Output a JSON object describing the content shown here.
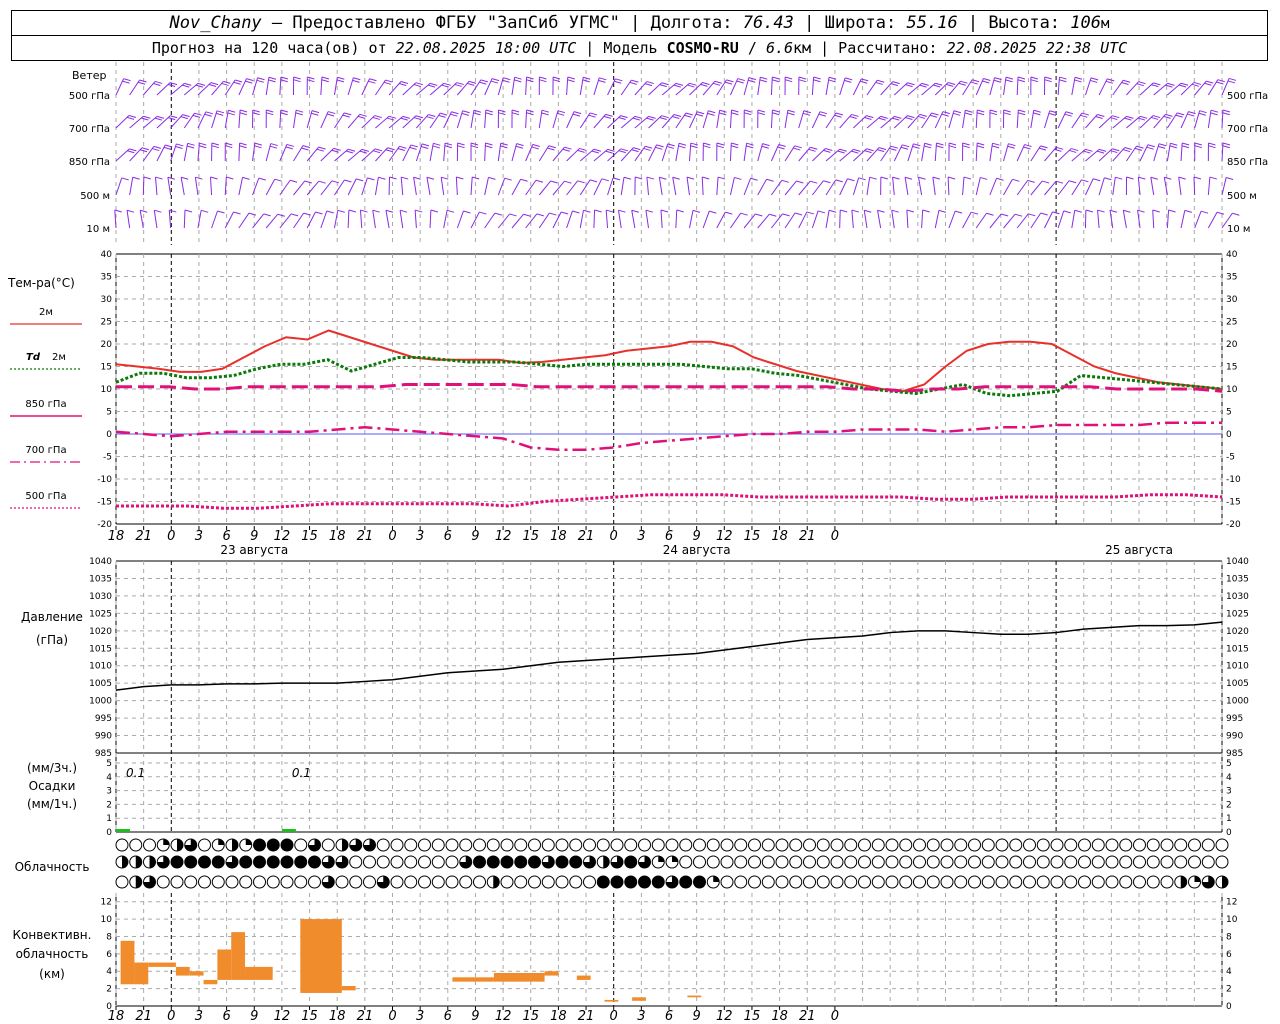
{
  "header": {
    "station": "Nov_Chany",
    "provided": " – Предоставлено ФГБУ \"ЗапСиб УГМС\" | Долгота: ",
    "lon": "76.43",
    "lat_label": " | Широта: ",
    "lat": "55.16",
    "alt_label": " | Высота: ",
    "alt": "106",
    "alt_unit": "м",
    "forecast_label": "Прогноз на 120 часа(ов) от ",
    "forecast_time": "22.08.2025 18:00 UTC",
    "model_label": " | Модель ",
    "model": "COSMO-RU",
    "model_sep": " / ",
    "model_res": "6.6",
    "model_res_unit": "км",
    "computed_label": " | Рассчитано: ",
    "computed_time": "22.08.2025 22:38 UTC"
  },
  "colors": {
    "wind": "#8a2be2",
    "t2m": "#e8302a",
    "td2m": "#0a7a0a",
    "t850": "#e0107a",
    "precip": "#22bb22",
    "convective": "#f08c2c",
    "pressure": "#000000"
  },
  "wind_panel": {
    "title": "Ветер",
    "levels": [
      "500 гПа",
      "700 гПа",
      "850 гПа",
      "500 м",
      "10 м"
    ]
  },
  "temp_panel": {
    "title": "Тем-ра(°C)",
    "legend": [
      {
        "label": "2м",
        "italic_prefix": "",
        "style": "solid",
        "color": "#e8302a"
      },
      {
        "label": "2м",
        "italic_prefix": "Td",
        "style": "dotted",
        "color": "#0a7a0a"
      },
      {
        "label": "850 гПа",
        "italic_prefix": "",
        "style": "solid",
        "color": "#e0107a"
      },
      {
        "label": "700 гПа",
        "italic_prefix": "",
        "style": "dashdot",
        "color": "#e0107a"
      },
      {
        "label": "500 гПа",
        "italic_prefix": "",
        "style": "dotted",
        "color": "#e0107a"
      }
    ]
  },
  "x_axis": {
    "hour_ticks": [
      "18",
      "21",
      "0",
      "3",
      "6",
      "9",
      "12",
      "15",
      "18",
      "21",
      "0",
      "3",
      "6",
      "9",
      "12",
      "15",
      "18",
      "21",
      "0",
      "3",
      "6",
      "9",
      "12",
      "15",
      "18",
      "21",
      "0"
    ],
    "dates": [
      "23 августа",
      "24 августа",
      "25 августа"
    ]
  },
  "pressure_panel": {
    "title": "Давление",
    "unit": "(гПа)"
  },
  "precip_panel": {
    "unit_top": "(мм/3ч.)",
    "title": "Осадки",
    "unit_bottom": "(мм/1ч.)",
    "labels": [
      "0.1",
      "0.1"
    ]
  },
  "cloud_panel": {
    "title": "Облачность"
  },
  "convective_panel": {
    "title_line1": "Конвективн.",
    "title_line2": "облачность",
    "unit": "(км)"
  },
  "chart_data": [
    {
      "type": "line",
      "panel": "temperature",
      "x_hours": [
        0,
        3,
        6,
        9,
        12,
        15,
        18,
        21,
        24,
        27,
        30,
        33,
        36,
        39,
        42,
        45,
        48,
        51,
        54,
        57,
        60,
        63,
        66,
        69,
        72,
        75,
        78,
        81,
        84,
        87,
        90,
        93,
        96,
        99,
        102,
        105,
        108,
        111,
        114,
        117,
        120
      ],
      "ylim": [
        -20,
        40
      ],
      "yticks": [
        -20,
        -15,
        -10,
        -5,
        0,
        5,
        10,
        15,
        20,
        25,
        30,
        35,
        40
      ],
      "series": [
        {
          "name": "2м",
          "values": [
            15.5,
            15,
            14.5,
            13.8,
            13.8,
            14.5,
            17,
            19.5,
            21.5,
            21,
            23,
            21.5,
            20,
            18.5,
            17,
            16.5,
            16.5,
            16.5,
            16.5,
            15.8,
            16,
            16.5,
            17,
            17.5,
            18.5,
            19,
            19.5,
            20.5,
            20.5,
            19.5,
            17,
            15.5,
            14,
            13,
            12,
            11,
            10,
            9.5,
            11,
            15,
            18.5,
            20,
            20.5,
            20.5,
            20,
            17.5,
            15,
            13.5,
            12.5,
            11.5,
            11,
            10.5,
            10
          ]
        },
        {
          "name": "Td 2м",
          "values": [
            11.5,
            13.5,
            13.5,
            12.5,
            12.5,
            13,
            14.5,
            15.5,
            15.5,
            16.5,
            14,
            15.5,
            17,
            17,
            16.5,
            16,
            16,
            16,
            15.5,
            15,
            15.5,
            15.5,
            15.5,
            15.5,
            15.5,
            15,
            14.5,
            14.5,
            13.5,
            13,
            12,
            11,
            10,
            9.5,
            9,
            10,
            11,
            9,
            8.5,
            9,
            9.5,
            13,
            12.5,
            12,
            11.5,
            11,
            10.5,
            10
          ]
        },
        {
          "name": "850 гПа",
          "values": [
            10.5,
            10.5,
            10.5,
            10,
            10,
            10.5,
            10.5,
            10.5,
            10.5,
            10.5,
            10.5,
            11,
            11,
            11,
            11,
            11,
            10.5,
            10.5,
            10.5,
            10.5,
            10.5,
            10.5,
            10.5,
            10.5,
            10.5,
            10.5,
            10.5,
            10.5,
            10,
            10,
            9.5,
            10,
            10,
            10.5,
            10.5,
            10.5,
            10.5,
            10.5,
            10,
            10,
            10,
            10,
            9.5
          ]
        },
        {
          "name": "700 гПа",
          "values": [
            0.5,
            0,
            -0.5,
            0,
            0.5,
            0.5,
            0.5,
            0.5,
            1,
            1.5,
            1,
            0.5,
            0,
            -0.5,
            -1,
            -3,
            -3.5,
            -3.5,
            -3,
            -2,
            -1.5,
            -1,
            -0.5,
            0,
            0,
            0.5,
            0.5,
            1,
            1,
            1,
            0.5,
            1,
            1.5,
            1.5,
            2,
            2,
            2,
            2,
            2.5,
            2.5,
            2.5
          ]
        },
        {
          "name": "500 гПа",
          "values": [
            -16,
            -16,
            -16,
            -16.5,
            -16.5,
            -16,
            -15.5,
            -15.5,
            -15.5,
            -15.5,
            -15.5,
            -16,
            -15,
            -14.5,
            -14,
            -13.5,
            -13.5,
            -13.5,
            -14,
            -14,
            -14,
            -14,
            -14,
            -14.5,
            -14.5,
            -14,
            -14,
            -14,
            -14,
            -13.5,
            -13.5,
            -14
          ]
        }
      ]
    },
    {
      "type": "line",
      "panel": "pressure",
      "ylabel": "Давление (гПа)",
      "ylim": [
        985,
        1040
      ],
      "yticks": [
        985,
        990,
        995,
        1000,
        1005,
        1010,
        1015,
        1020,
        1025,
        1030,
        1035,
        1040
      ],
      "x_hours": [
        0,
        3,
        6,
        9,
        12,
        15,
        18,
        21,
        24,
        27,
        30,
        33,
        36,
        39,
        42,
        45,
        48,
        51,
        54,
        57,
        60,
        63,
        66,
        69,
        72,
        75,
        78,
        81,
        84,
        87,
        90,
        93,
        96,
        99,
        102,
        105,
        108,
        111,
        114,
        117,
        120
      ],
      "values": [
        1003,
        1004,
        1004.5,
        1004.5,
        1004.8,
        1004.8,
        1005,
        1005,
        1005,
        1005.5,
        1006,
        1007,
        1008,
        1008.5,
        1009,
        1010,
        1011,
        1011.5,
        1012,
        1012.5,
        1013,
        1013.5,
        1014.5,
        1015.5,
        1016.5,
        1017.5,
        1018,
        1018.5,
        1019.5,
        1020,
        1020,
        1019.5,
        1019,
        1019,
        1019.5,
        1020.5,
        1021,
        1021.5,
        1021.5,
        1021.7,
        1022.5
      ]
    },
    {
      "type": "bar",
      "panel": "precipitation",
      "ylabel": "Осадки",
      "ylim": [
        0,
        5
      ],
      "yticks": [
        0,
        1,
        2,
        3,
        4,
        5
      ],
      "x_hours": [
        0,
        18
      ],
      "values": [
        0.1,
        0.1
      ]
    },
    {
      "type": "bar",
      "panel": "convective cloud",
      "ylabel": "Конвективн. облачность (км)",
      "ylim": [
        0,
        13
      ],
      "yticks": [
        0,
        2,
        4,
        6,
        8,
        10,
        12
      ],
      "bars": [
        {
          "x_from": 0.5,
          "x_to": 2,
          "base": 2.5,
          "top": 7.5
        },
        {
          "x_from": 2,
          "x_to": 3.5,
          "base": 2.5,
          "top": 5
        },
        {
          "x_from": 3.5,
          "x_to": 6.5,
          "base": 4.5,
          "top": 5
        },
        {
          "x_from": 6.5,
          "x_to": 8,
          "base": 3.5,
          "top": 4.5
        },
        {
          "x_from": 8,
          "x_to": 9.5,
          "base": 3.5,
          "top": 4
        },
        {
          "x_from": 9.5,
          "x_to": 11,
          "base": 2.5,
          "top": 3
        },
        {
          "x_from": 11,
          "x_to": 12.5,
          "base": 3,
          "top": 6.5
        },
        {
          "x_from": 12.5,
          "x_to": 14,
          "base": 3,
          "top": 8.5
        },
        {
          "x_from": 14,
          "x_to": 17,
          "base": 3,
          "top": 4.5
        },
        {
          "x_from": 20,
          "x_to": 24.5,
          "base": 1.5,
          "top": 10
        },
        {
          "x_from": 24.5,
          "x_to": 26,
          "base": 1.8,
          "top": 2.3
        },
        {
          "x_from": 36.5,
          "x_to": 41,
          "base": 2.8,
          "top": 3.3
        },
        {
          "x_from": 41,
          "x_to": 46.5,
          "base": 2.8,
          "top": 3.8
        },
        {
          "x_from": 46.5,
          "x_to": 48,
          "base": 3.5,
          "top": 4
        },
        {
          "x_from": 50,
          "x_to": 51.5,
          "base": 3,
          "top": 3.5
        },
        {
          "x_from": 53,
          "x_to": 54.5,
          "base": 0.5,
          "top": 0.7
        },
        {
          "x_from": 56,
          "x_to": 57.5,
          "base": 0.6,
          "top": 1
        },
        {
          "x_from": 62,
          "x_to": 63.5,
          "base": 1,
          "top": 1.2
        }
      ]
    },
    {
      "type": "table",
      "panel": "cloudiness",
      "title": "Облачность",
      "note": "Cloud cover symbols, 3 rows (upper, middle, lower cloud), 0 = clear, 4 = overcast",
      "rows": [
        [
          0,
          0,
          0,
          1,
          2,
          3,
          0,
          1,
          2,
          1,
          4,
          4,
          4,
          0,
          3,
          0,
          2,
          3,
          3,
          0,
          0,
          0,
          0,
          0,
          0,
          0,
          0,
          0,
          0,
          0,
          0,
          0,
          0,
          0,
          0,
          0,
          0,
          0,
          0,
          0,
          0,
          0,
          0,
          0,
          0,
          0,
          0,
          0,
          0,
          0,
          0,
          0,
          0,
          0,
          0,
          0,
          0,
          0,
          0,
          0,
          0,
          0,
          0,
          0,
          0,
          0,
          0,
          0,
          0,
          0,
          0,
          0,
          0,
          0,
          0,
          0,
          0,
          0,
          0,
          0,
          0
        ],
        [
          2,
          2,
          2,
          3,
          4,
          4,
          4,
          4,
          3,
          4,
          4,
          4,
          4,
          4,
          4,
          3,
          3,
          0,
          0,
          0,
          0,
          0,
          0,
          0,
          0,
          3,
          4,
          4,
          4,
          4,
          4,
          3,
          4,
          4,
          3,
          2,
          3,
          4,
          3,
          1,
          1,
          0,
          0,
          0,
          0,
          0,
          0,
          0,
          0,
          0,
          0,
          0,
          0,
          0,
          0,
          0,
          0,
          0,
          0,
          0,
          0,
          0,
          0,
          0,
          0,
          0,
          0,
          0,
          0,
          0,
          0,
          0,
          0,
          0,
          0,
          0,
          0,
          0,
          0,
          0,
          0
        ],
        [
          0,
          2,
          3,
          0,
          0,
          0,
          0,
          0,
          0,
          0,
          0,
          0,
          0,
          0,
          0,
          3,
          0,
          0,
          0,
          3,
          0,
          0,
          0,
          0,
          0,
          0,
          0,
          2,
          0,
          0,
          0,
          0,
          0,
          0,
          0,
          4,
          4,
          4,
          4,
          4,
          3,
          4,
          4,
          1,
          0,
          0,
          0,
          0,
          0,
          0,
          0,
          0,
          0,
          0,
          0,
          0,
          0,
          0,
          0,
          0,
          0,
          0,
          0,
          0,
          0,
          0,
          0,
          0,
          0,
          0,
          0,
          0,
          0,
          0,
          0,
          0,
          0,
          2,
          1,
          3,
          2
        ]
      ]
    }
  ]
}
